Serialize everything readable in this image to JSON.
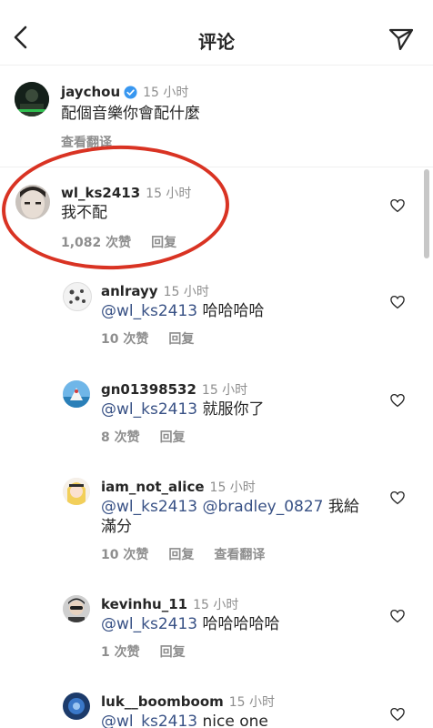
{
  "header": {
    "title": "评论",
    "back_icon": "chevron-left-icon",
    "send_icon": "paper-plane-icon"
  },
  "caption": {
    "username": "jaychou",
    "time": "15 小时",
    "text": "配個音樂你會配什麼",
    "translate_label": "查看翻译",
    "verified_color": "#3897f0"
  },
  "main_comment": {
    "username": "wl_ks2413",
    "time": "15 小时",
    "text": "我不配",
    "likes": "1,082 次赞",
    "reply_label": "回复"
  },
  "replies": [
    {
      "username": "anlrayy",
      "time": "15 小时",
      "mention": "@wl_ks2413",
      "text": " 哈哈哈哈",
      "likes": "10 次赞",
      "reply_label": "回复"
    },
    {
      "username": "gn01398532",
      "time": "15 小时",
      "mention": "@wl_ks2413",
      "text": " 就服你了",
      "likes": "8 次赞",
      "reply_label": "回复"
    },
    {
      "username": "iam_not_alice",
      "time": "15 小时",
      "mention": "@wl_ks2413 @bradley_0827",
      "text": " 我給",
      "text2": "滿分",
      "likes": "10 次赞",
      "reply_label": "回复",
      "translate_label": "查看翻译"
    },
    {
      "username": "kevinhu_11",
      "time": "15 小时",
      "mention": "@wl_ks2413",
      "text": " 哈哈哈哈哈",
      "likes": "1 次赞",
      "reply_label": "回复"
    },
    {
      "username": "luk__boomboom",
      "time": "15 小时",
      "mention": "@wl_ks2413",
      "text": " nice one"
    }
  ],
  "colors": {
    "mention": "#385185",
    "highlight": "#d93323",
    "secondary_text": "#8e8e8e"
  }
}
